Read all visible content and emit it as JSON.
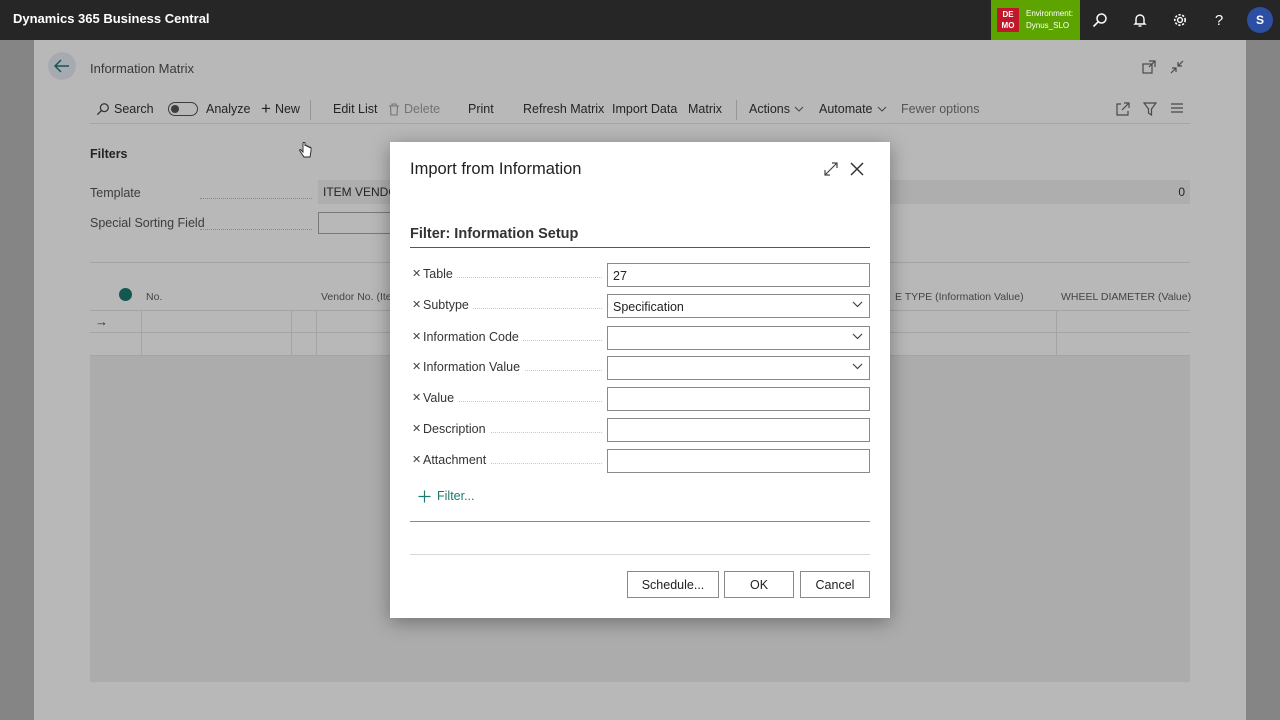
{
  "app": {
    "title": "Dynamics 365 Business Central",
    "env_badge": [
      "DE",
      "MO"
    ],
    "env_label": "Environment:",
    "env_name": "Dynus_SLO",
    "avatar_letter": "S",
    "brand_color": "#262626",
    "env_color": "#5ea400"
  },
  "page": {
    "title": "Information Matrix",
    "toolbar": {
      "search": "Search",
      "analyze": "Analyze",
      "new": "New",
      "edit_list": "Edit List",
      "delete": "Delete",
      "print": "Print",
      "refresh_matrix": "Refresh Matrix",
      "import_data": "Import Data",
      "matrix": "Matrix",
      "actions": "Actions",
      "automate": "Automate",
      "fewer_options": "Fewer options"
    },
    "filters": {
      "heading": "Filters",
      "template_label": "Template",
      "template_value": "ITEM VENDO",
      "template_count": "0",
      "special_sorting_label": "Special Sorting Field",
      "special_sorting_value": ""
    },
    "grid": {
      "columns": [
        "No.",
        "Vendor No. (Ite",
        "E TYPE (Information Value)",
        "WHEEL DIAMETER (Value)"
      ]
    }
  },
  "dialog": {
    "title": "Import from Information",
    "section": "Filter: Information Setup",
    "fields": [
      {
        "label": "Table",
        "value": "27",
        "dropdown": false
      },
      {
        "label": "Subtype",
        "value": "Specification",
        "dropdown": true
      },
      {
        "label": "Information Code",
        "value": "",
        "dropdown": true
      },
      {
        "label": "Information Value",
        "value": "",
        "dropdown": true
      },
      {
        "label": "Value",
        "value": "",
        "dropdown": false
      },
      {
        "label": "Description",
        "value": "",
        "dropdown": false
      },
      {
        "label": "Attachment",
        "value": "",
        "dropdown": false
      }
    ],
    "add_filter": "Filter...",
    "buttons": {
      "schedule": "Schedule...",
      "ok": "OK",
      "cancel": "Cancel"
    }
  }
}
